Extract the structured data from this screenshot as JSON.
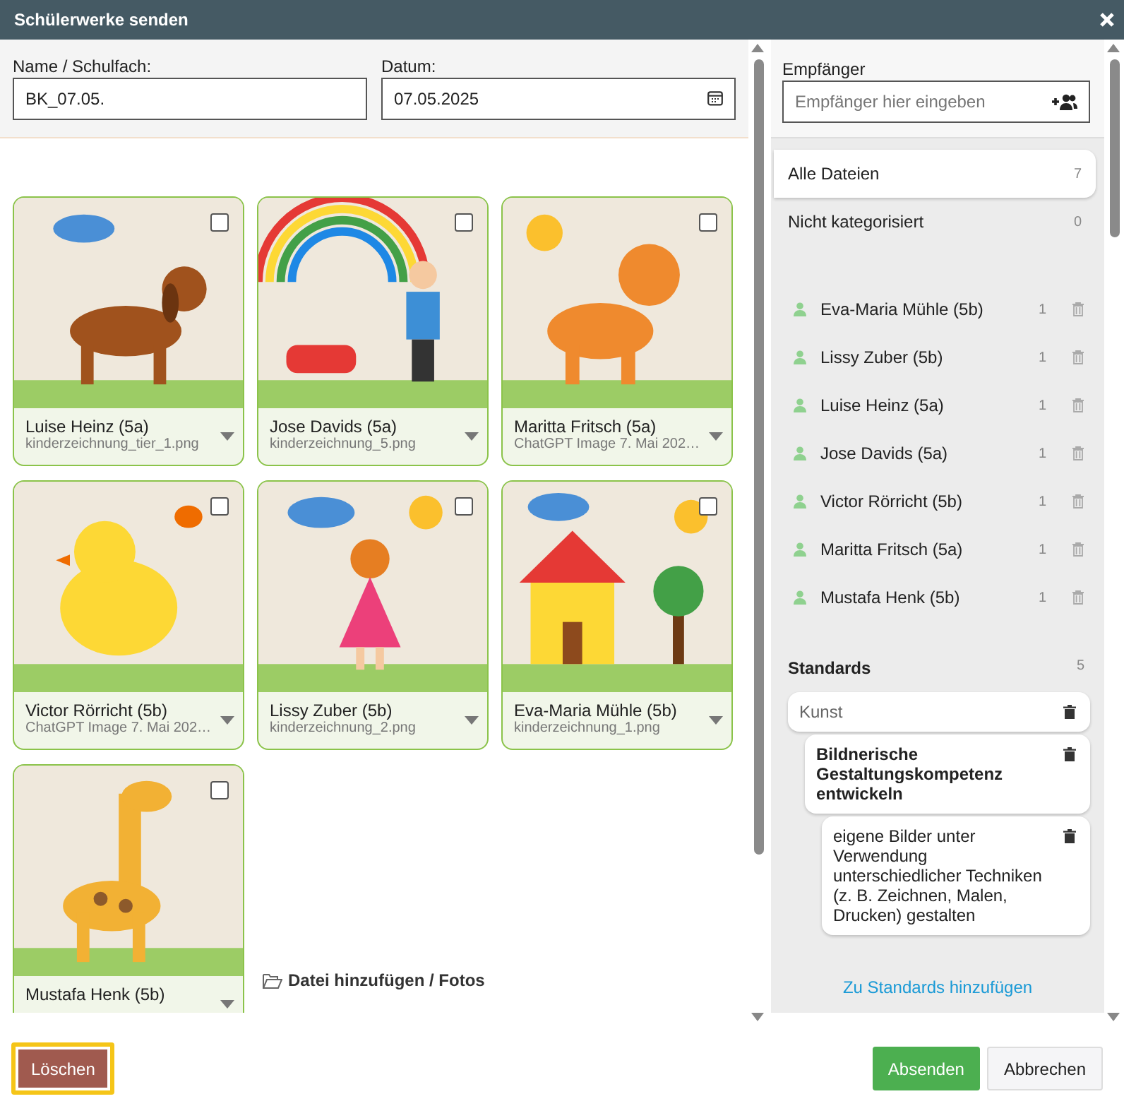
{
  "window": {
    "title": "Schülerwerke senden"
  },
  "form": {
    "name_label": "Name / Schulfach:",
    "name_value": "BK_07.05.",
    "date_label": "Datum:",
    "date_value": "07.05.2025"
  },
  "cards": [
    {
      "name": "Luise Heinz (5a)",
      "file": "kinderzeichnung_tier_1.png",
      "checked": false
    },
    {
      "name": "Jose Davids (5a)",
      "file": "kinderzeichnung_5.png",
      "checked": false
    },
    {
      "name": "Maritta Fritsch (5a)",
      "file": "ChatGPT Image 7. Mai 202…",
      "checked": false
    },
    {
      "name": "Victor Rörricht (5b)",
      "file": "ChatGPT Image 7. Mai 202…",
      "checked": false
    },
    {
      "name": "Lissy Zuber (5b)",
      "file": "kinderzeichnung_2.png",
      "checked": false
    },
    {
      "name": "Eva-Maria Mühle (5b)",
      "file": "kinderzeichnung_1.png",
      "checked": false
    },
    {
      "name": "Mustafa Henk (5b)",
      "checked": false
    }
  ],
  "add_files": "Datei hinzufügen / Fotos",
  "recipients": {
    "label": "Empfänger",
    "placeholder": "Empfänger hier eingeben"
  },
  "categories": [
    {
      "label": "Alle Dateien",
      "count": "7",
      "selected": true
    },
    {
      "label": "Nicht kategorisiert",
      "count": "0",
      "selected": false
    }
  ],
  "students": [
    {
      "name": "Eva-Maria Mühle (5b)",
      "count": "1"
    },
    {
      "name": "Lissy Zuber (5b)",
      "count": "1"
    },
    {
      "name": "Luise Heinz (5a)",
      "count": "1"
    },
    {
      "name": "Jose Davids (5a)",
      "count": "1"
    },
    {
      "name": "Victor Rörricht (5b)",
      "count": "1"
    },
    {
      "name": "Maritta Fritsch (5a)",
      "count": "1"
    },
    {
      "name": "Mustafa Henk (5b)",
      "count": "1"
    }
  ],
  "standards": {
    "title": "Standards",
    "count": "5",
    "items": [
      {
        "label": "Kunst",
        "children": [
          {
            "label": "Bildnerische Gestaltungskompetenz entwickeln",
            "children": [
              {
                "label": "eigene Bilder unter Verwendung unterschiedlicher Techniken (z. B. Zeichnen, Malen, Drucken) gestalten"
              }
            ]
          }
        ]
      }
    ]
  },
  "standards_link": "Zu Standards hinzufügen",
  "buttons": {
    "delete": {
      "label": "Löschen",
      "focused": true
    },
    "send": "Absenden",
    "cancel": "Abbrechen"
  }
}
